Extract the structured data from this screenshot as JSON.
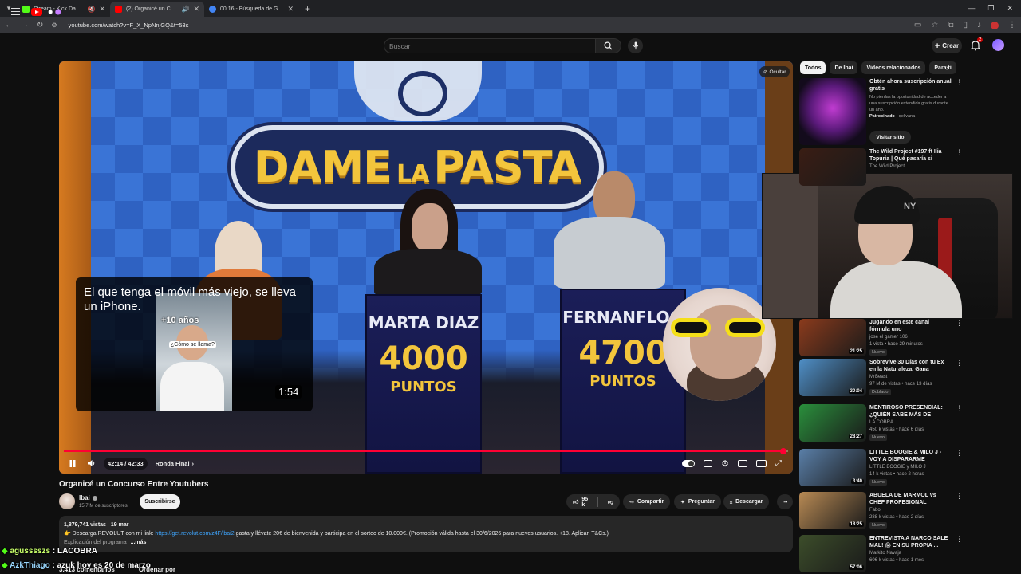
{
  "browser": {
    "tabs": [
      {
        "title": "Stream - Kick Dashboard",
        "color": "#53fc18",
        "active": false
      },
      {
        "title": "(2) Organicé un Concurso E",
        "color": "#ff0000",
        "active": true
      },
      {
        "title": "00:16 - Búsqueda de Google",
        "color": "#4285f4",
        "active": false
      }
    ],
    "url": "youtube.com/watch?v=F_X_NpNnjGQ&t=53s"
  },
  "header": {
    "search_placeholder": "Buscar",
    "create_label": "Crear",
    "notification_count": "2"
  },
  "player": {
    "hide_label": "Ocultar",
    "sign_word1": "DAME",
    "sign_word2": "LA",
    "sign_word3": "PASTA",
    "podiums": [
      {
        "name": "MARTA DIAZ",
        "score": "4000",
        "points_label": "PUNTOS"
      },
      {
        "name": "FERNANFLOO",
        "score": "4700",
        "points_label": "PUNTOS"
      }
    ],
    "pip": {
      "text": "El que tenga el móvil más viejo, se lleva un iPhone.",
      "tag1": "+10 años",
      "tag2": "¿Cómo se llama?",
      "duration": "1:54"
    },
    "time": "42:14 / 42:33",
    "chapter": "Ronda Final",
    "progress_fraction": 0.993
  },
  "webcam": {
    "cap_logo": "NY"
  },
  "video": {
    "title": "Organicé un Concurso Entre Youtubers",
    "channel": "Ibai",
    "subscribers": "15.7 M de suscriptores",
    "subscribe_label": "Suscribirse",
    "likes": "95 k",
    "share_label": "Compartir",
    "clip_label": "Preguntar",
    "download_label": "Descargar",
    "views": "1,879,741 vistas",
    "date": "19 mar",
    "desc_prefix": "Descarga REVOLUT con mi link: ",
    "desc_link": "https://get.revolut.com/z4F/ibai2",
    "desc_suffix": " gasta y llévate 20€ de bienvenida y participa en el sorteo de 10.000€. (Promoción válida hasta el 30/6/2026 para nuevos usuarios. +18. Aplican T&Cs.)",
    "desc_line2": "Explicación del programa",
    "more_label": "...más",
    "comments": "3.413 comentarios",
    "sort_label": "Ordenar por"
  },
  "chat": [
    {
      "user": "agusssszs",
      "message": "LACOBRA"
    },
    {
      "user": "AzkThiago",
      "message": "azuk hoy es 20 de marzo"
    }
  ],
  "sidebar": {
    "chips": [
      "Todos",
      "De Ibai",
      "Videos relacionados",
      "Para ti"
    ],
    "ad": {
      "title": "Obtén ahora suscripción anual gratis",
      "description": "No pierdas la oportunidad de acceder a una suscripción extendida gratis durante un año.",
      "sponsored_label": "Patrocinado",
      "advertiser": "qelivana",
      "button": "Visitar sitio"
    },
    "items": [
      {
        "title": "The Wild Project #197 ft Ilia Topuria | Qué pasaría si alguie...",
        "channel": "The Wild Project",
        "views": "",
        "badge": "",
        "duration": "",
        "thumb": "#3a1d14"
      },
      {
        "title": "Jugando en este canal fórmula uno",
        "channel": "jose el gamer 106",
        "views": "1 vista • hace 29 minutos",
        "badge": "Nuevo",
        "duration": "21:25",
        "thumb": "#8b3b1c"
      },
      {
        "title": "Sobrevive 30 Días con tu Ex en la Naturaleza, Gana $250,000",
        "channel": "MrBeast",
        "views": "97 M de vistas • hace 13 días",
        "badge": "Doblado",
        "duration": "30:04",
        "thumb": "#4f8fc7"
      },
      {
        "title": "MENTIROSO PRESENCIAL: ¿QUIÉN SABE MÁS DE FÚTBO...",
        "channel": "LA COBRA",
        "views": "450 k vistas • hace 6 días",
        "badge": "Nuevo",
        "duration": "28:27",
        "thumb": "#2a8f3c"
      },
      {
        "title": "LITTLE BOOGIE & MILO J - VOY A DISPARARME (VIDEOCLIP ...",
        "channel": "LITTLE BOOGIE y MILO J",
        "views": "14 k vistas • hace 2 horas",
        "badge": "Nuevo",
        "duration": "3:40",
        "thumb": "#5a7fa8"
      },
      {
        "title": "ABUELA DE MARMOL vs CHEF PROFESIONAL",
        "channel": "Fabo",
        "views": "288 k vistas • hace 2 días",
        "badge": "Nuevo",
        "duration": "18:25",
        "thumb": "#b88a54"
      },
      {
        "title": "ENTREVISTA A NARCO SALE MAL! 😱 EN SU PROPIA ...",
        "channel": "Markito Navaja",
        "views": "606 k vistas • hace 1 mes",
        "badge": "",
        "duration": "57:06",
        "thumb": "#3c4d2a"
      }
    ]
  }
}
